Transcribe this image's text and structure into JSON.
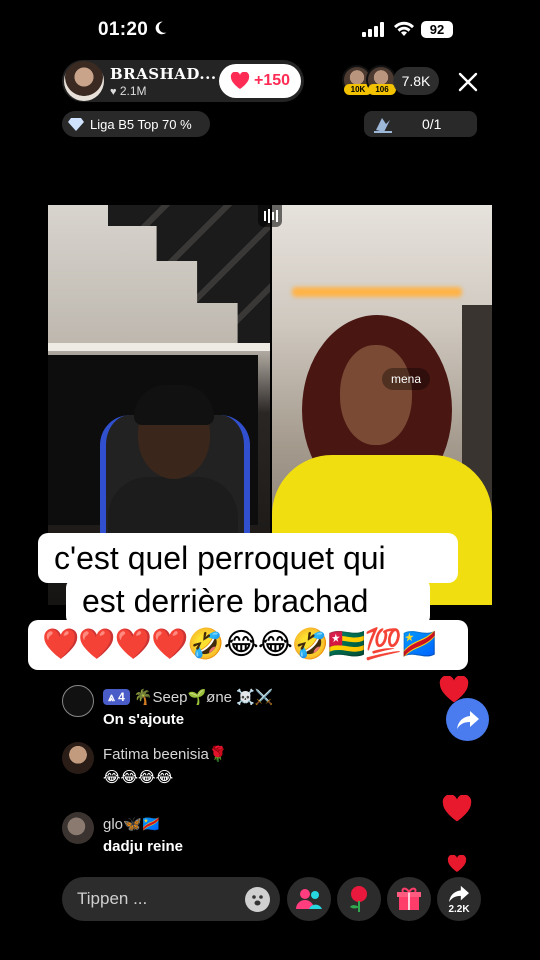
{
  "status_bar": {
    "time": "01:20",
    "battery": "92"
  },
  "host": {
    "name": "BRASHAD...",
    "likes": "2.1M",
    "follow_label": "+150"
  },
  "viewers": {
    "badge_1": "10K",
    "badge_2": "106",
    "count": "7.8K"
  },
  "league": {
    "label": "Liga B5 Top 70 %"
  },
  "goal": {
    "progress": "0/1"
  },
  "video": {
    "right_name_tag": "mena"
  },
  "caption": {
    "line1": "c'est quel perroquet qui",
    "line2": "est derrière brachad",
    "line3": "❤️❤️❤️❤️🤣😂😂🤣🇹🇬💯🇨🇩"
  },
  "comments": [
    {
      "level": "4",
      "user": "🌴Seep🌱øne ☠️⚔️",
      "message": "On s'ajoute"
    },
    {
      "user": "Fatima beenisia🌹",
      "message": "😂😂😂😂"
    },
    {
      "user": "glo🦋🇨🇩",
      "message": "dadju reine"
    }
  ],
  "bottom_bar": {
    "input_placeholder": "Tippen ...",
    "share_count": "2.2K"
  },
  "colors": {
    "accent": "#fe2c55",
    "share_fab": "#4a7cf0",
    "level_badge": "#4a5cc8"
  }
}
